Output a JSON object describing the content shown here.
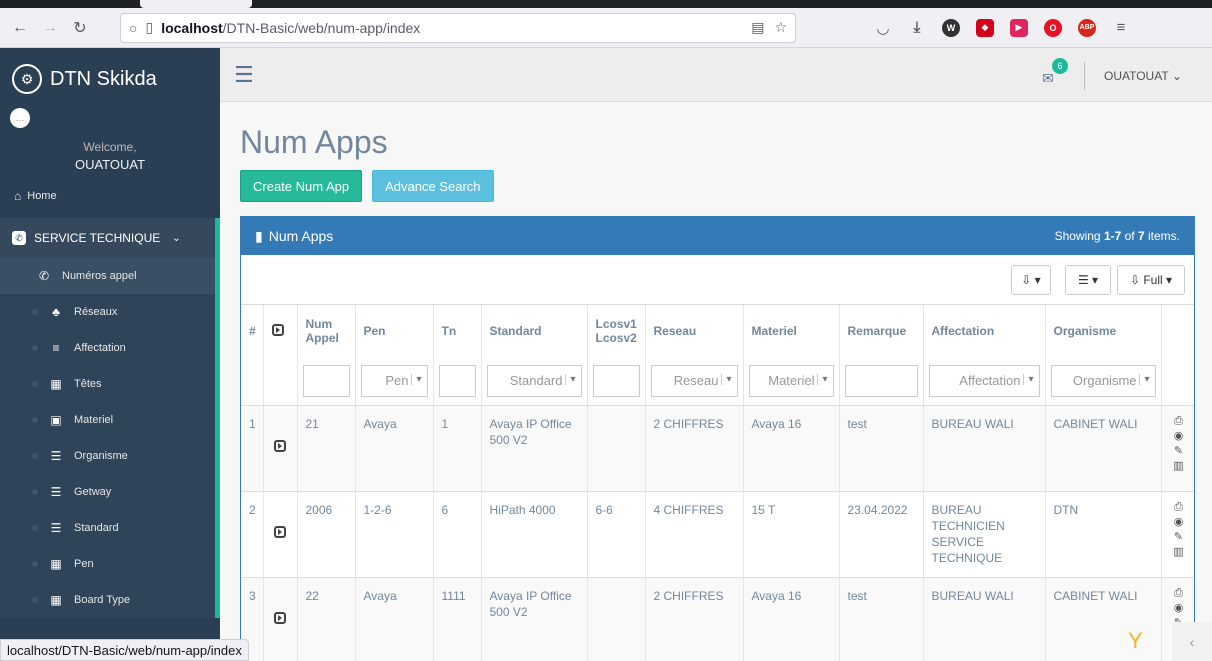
{
  "browser": {
    "url_host": "localhost",
    "url_path": "/DTN-Basic/web/num-app/index",
    "status_url": "localhost/DTN-Basic/web/num-app/index"
  },
  "sidebar": {
    "brand": "DTN Skikda",
    "welcome": "Welcome,",
    "username": "OUATOUAT",
    "home": "Home",
    "section": "SERVICE TECHNIQUE",
    "items": [
      {
        "label": "Numéros appel",
        "icon": "phone-icon"
      },
      {
        "label": "Réseaux",
        "icon": "sitemap-icon"
      },
      {
        "label": "Affectation",
        "icon": "bars-icon"
      },
      {
        "label": "Têtes",
        "icon": "table-icon"
      },
      {
        "label": "Materiel",
        "icon": "tv-icon"
      },
      {
        "label": "Organisme",
        "icon": "list-icon"
      },
      {
        "label": "Getway",
        "icon": "list-icon"
      },
      {
        "label": "Standard",
        "icon": "list-icon"
      },
      {
        "label": "Pen",
        "icon": "table-icon"
      },
      {
        "label": "Board Type",
        "icon": "table-icon"
      }
    ]
  },
  "topnav": {
    "mail_count": "6",
    "user": "OUATOUAT"
  },
  "page": {
    "title": "Num Apps",
    "create_btn": "Create Num App",
    "search_btn": "Advance Search"
  },
  "panel": {
    "title": "Num Apps",
    "summary_prefix": "Showing ",
    "summary_range": "1-7",
    "summary_mid": " of ",
    "summary_total": "7",
    "summary_suffix": " items.",
    "full_label": "Full"
  },
  "table": {
    "headers": [
      "#",
      "",
      "Num Appel",
      "Pen",
      "Tn",
      "Standard",
      "Lcosv1 Lcosv2",
      "Reseau",
      "Materiel",
      "Remarque",
      "Affectation",
      "Organisme",
      ""
    ],
    "filters": {
      "pen": "Pen",
      "standard": "Standard",
      "reseau": "Reseau",
      "materiel": "Materiel",
      "affectation": "Affectation",
      "organisme": "Organisme"
    },
    "rows": [
      {
        "n": "1",
        "num": "21",
        "pen": "Avaya",
        "tn": "1",
        "standard": "Avaya IP Office 500 V2",
        "lcos": "",
        "reseau": "2 CHIFFRES",
        "materiel": "Avaya 16",
        "remarque": "test",
        "affectation": "BUREAU WALI",
        "organisme": "CABINET WALI"
      },
      {
        "n": "2",
        "num": "2006",
        "pen": "1-2-6",
        "tn": "6",
        "standard": "HiPath 4000",
        "lcos": "6-6",
        "reseau": "4 CHIFFRES",
        "materiel": "15 T",
        "remarque": "23.04.2022",
        "affectation": "BUREAU TECHNICIEN SERVICE TECHNIQUE",
        "organisme": "DTN"
      },
      {
        "n": "3",
        "num": "22",
        "pen": "Avaya",
        "tn": "1111",
        "standard": "Avaya IP Office 500 V2",
        "lcos": "",
        "reseau": "2 CHIFFRES",
        "materiel": "Avaya 16",
        "remarque": "test",
        "affectation": "BUREAU WALI",
        "organisme": "CABINET WALI"
      }
    ]
  }
}
